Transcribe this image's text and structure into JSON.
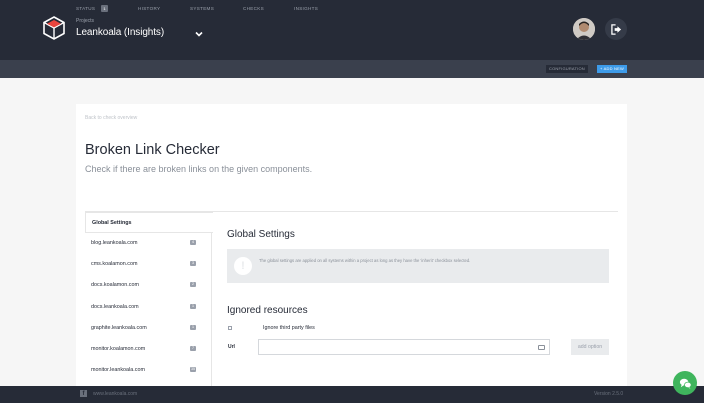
{
  "header": {
    "project_label": "Projects",
    "project_name": "Leankoala (Insights)"
  },
  "nav": {
    "items": [
      {
        "label": "STATUS",
        "badge": "1"
      },
      {
        "label": "HISTORY"
      },
      {
        "label": "SYSTEMS"
      },
      {
        "label": "CHECKS"
      },
      {
        "label": "INSIGHTS"
      }
    ],
    "configuration": "CONFIGURATION",
    "add_new": "+ ADD NEW"
  },
  "page": {
    "back_link": "Back to check overview",
    "title": "Broken Link Checker",
    "subtitle": "Check if there are broken links on the given components."
  },
  "sidebar": {
    "active": "Global Settings",
    "items": [
      {
        "label": "blog.leankoala.com",
        "count": "4"
      },
      {
        "label": "cms.koalamon.com",
        "count": "3"
      },
      {
        "label": "docs.koalamon.com",
        "count": "2"
      },
      {
        "label": "docs.leankoala.com",
        "count": "1"
      },
      {
        "label": "graphite.leankoala.com",
        "count": "1"
      },
      {
        "label": "monitor.koalamon.com",
        "count": "7"
      },
      {
        "label": "monitor.leankoala.com",
        "count": "35"
      }
    ]
  },
  "global_settings": {
    "title": "Global Settings",
    "info": "The global settings are applied on all systems within a project as long as they have the 'inherit' checkbox selected."
  },
  "ignored_resources": {
    "title": "Ignored resources",
    "ignore_third_party": "Ignore third party files",
    "url_label": "Url",
    "url_value": "",
    "add_option": "add option"
  },
  "footer": {
    "link": "www.leankoala.com",
    "version": "Version 2.5.0"
  },
  "colors": {
    "header_bg": "#262b37",
    "nav_bg": "#3a404d",
    "accent": "#3d9be9",
    "chat": "#3fb55d"
  }
}
